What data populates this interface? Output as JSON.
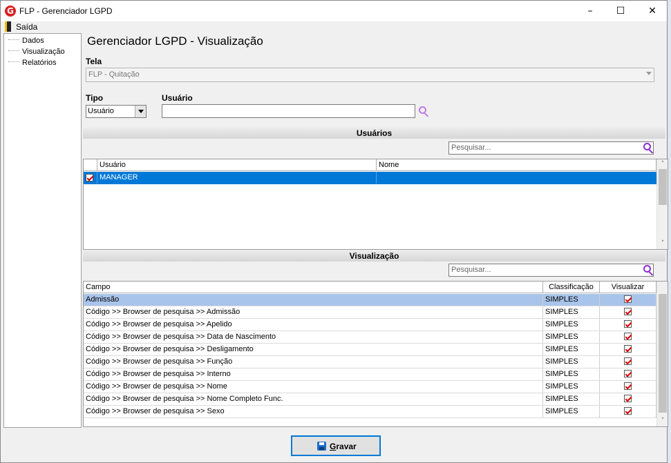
{
  "window": {
    "title": "FLP - Gerenciador LGPD",
    "app_icon_letter": "G"
  },
  "menu": {
    "exit_label": "Saída"
  },
  "tree": {
    "items": [
      "Dados",
      "Visualização",
      "Relatórios"
    ]
  },
  "main": {
    "title": "Gerenciador LGPD - Visualização",
    "tela_label": "Tela",
    "tela_value": "FLP - Quitação",
    "tipo_label": "Tipo",
    "tipo_value": "Usuário",
    "usuario_label": "Usuário",
    "usuario_value": ""
  },
  "users_section": {
    "header": "Usuários",
    "search_placeholder": "Pesquisar...",
    "columns": [
      "Usuário",
      "Nome"
    ],
    "rows": [
      {
        "usuario": "MANAGER",
        "nome": "",
        "checked": true,
        "selected": true
      }
    ]
  },
  "view_section": {
    "header": "Visualização",
    "search_placeholder": "Pesquisar...",
    "columns": [
      "Campo",
      "Classificação",
      "Visualizar"
    ],
    "rows": [
      {
        "campo": "Admissão",
        "classificacao": "SIMPLES",
        "visualizar": true
      },
      {
        "campo": "Código >> Browser de pesquisa >> Admissão",
        "classificacao": "SIMPLES",
        "visualizar": true
      },
      {
        "campo": "Código >> Browser de pesquisa >> Apelido",
        "classificacao": "SIMPLES",
        "visualizar": true
      },
      {
        "campo": "Código >> Browser de pesquisa >> Data de Nascimento",
        "classificacao": "SIMPLES",
        "visualizar": true
      },
      {
        "campo": "Código >> Browser de pesquisa >> Desligamento",
        "classificacao": "SIMPLES",
        "visualizar": true
      },
      {
        "campo": "Código >> Browser de pesquisa >> Função",
        "classificacao": "SIMPLES",
        "visualizar": true
      },
      {
        "campo": "Código >> Browser de pesquisa >> Interno",
        "classificacao": "SIMPLES",
        "visualizar": true
      },
      {
        "campo": "Código >> Browser de pesquisa >> Nome",
        "classificacao": "SIMPLES",
        "visualizar": true
      },
      {
        "campo": "Código >> Browser de pesquisa >> Nome Completo Func.",
        "classificacao": "SIMPLES",
        "visualizar": true
      },
      {
        "campo": "Código >> Browser de pesquisa >> Sexo",
        "classificacao": "SIMPLES",
        "visualizar": true
      }
    ]
  },
  "footer": {
    "save_mnemonic": "G",
    "save_rest": "ravar"
  },
  "colors": {
    "selection": "#0078d7",
    "selection_light": "#a9c4ea",
    "accent": "#8b2bd0"
  }
}
